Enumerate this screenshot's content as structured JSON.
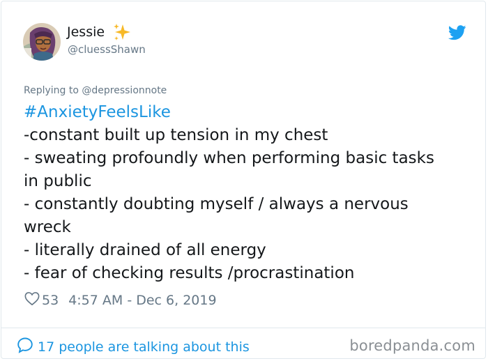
{
  "user": {
    "display_name": "Jessie",
    "handle": "@cluessShawn",
    "avatar_icon": "avatar-illustration",
    "name_emoji": "sparkles-icon"
  },
  "brand_icon": "twitter-bird-icon",
  "reply": {
    "prefix": "Replying to",
    "mention": "@depressionnote"
  },
  "tweet": {
    "hashtag": "#AnxietyFeelsLike",
    "lines": [
      "-constant built up tension in my chest",
      "- sweating profoundly when performing basic tasks",
      "in public",
      "- constantly doubting myself / always a nervous",
      "wreck",
      "- literally drained of all energy",
      "- fear of checking results /procrastination"
    ]
  },
  "meta": {
    "like_count": "53",
    "timestamp": "4:57 AM - Dec 6, 2019"
  },
  "footer": {
    "talking": "17 people are talking about this"
  },
  "watermark": "boredpanda.com",
  "colors": {
    "accent": "#1b95e0",
    "muted": "#657786",
    "text": "#14171a",
    "border": "#e1e8ed"
  }
}
